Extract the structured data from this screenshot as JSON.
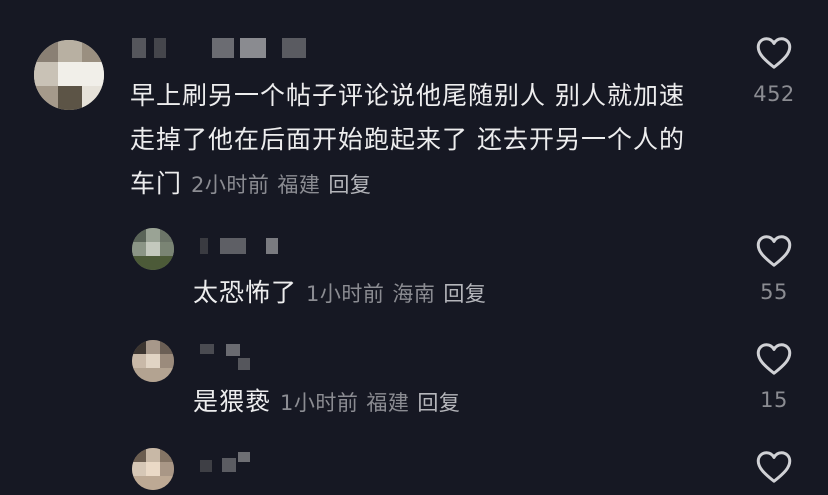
{
  "comments": [
    {
      "text_lines": [
        "早上刷另一个帖子评论说他尾随别人 别人就加速",
        "走掉了他在后面开始跑起来了 还去开另一个人的",
        "车门"
      ],
      "time": "2小时前",
      "location": "福建",
      "reply_label": "回复",
      "likes": "452"
    },
    {
      "text": "太恐怖了",
      "time": "1小时前",
      "location": "海南",
      "reply_label": "回复",
      "likes": "55"
    },
    {
      "text": "是猥亵",
      "time": "1小时前",
      "location": "福建",
      "reply_label": "回复",
      "likes": "15"
    }
  ],
  "icons": {
    "like": "heart-outline-icon"
  },
  "colors": {
    "background": "#161823",
    "text": "#ededee",
    "meta": "#8b8c92"
  }
}
